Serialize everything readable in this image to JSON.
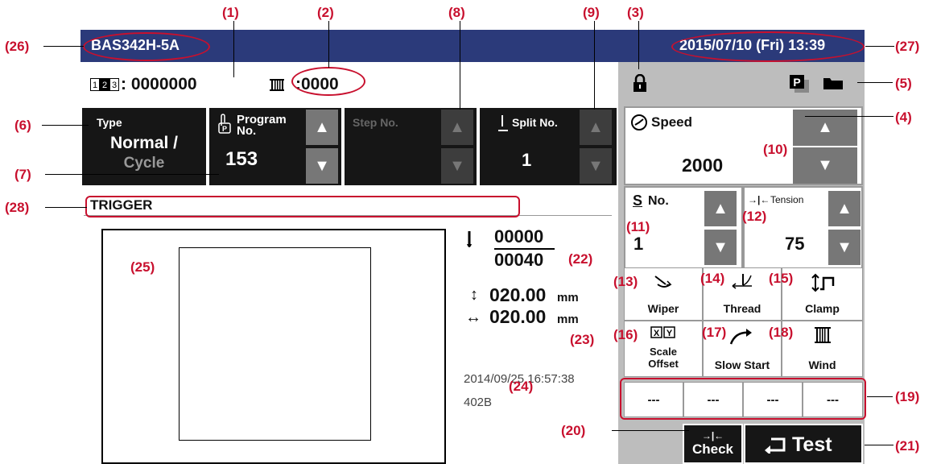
{
  "title_bar": {
    "model": "BAS342H-5A",
    "datetime": "2015/07/10 (Fri) 13:39"
  },
  "counters": {
    "production_count": ": 0000000",
    "bobbin_count": ":0000"
  },
  "tiles": {
    "type": {
      "label": "Type",
      "value_line1": "Normal /",
      "value_line2": "Cycle"
    },
    "program": {
      "label_line1": "Program",
      "label_line2": "No.",
      "value": "153"
    },
    "step": {
      "label": "Step No.",
      "value": ""
    },
    "split": {
      "label": "Split No.",
      "value": "1"
    }
  },
  "trigger_label": "TRIGGER",
  "stitch": {
    "current": "00000",
    "total": "00040"
  },
  "dimensions": {
    "height": "020.00",
    "width": "020.00",
    "unit": "mm"
  },
  "file_info": {
    "date": "2014/09/25 16:57:38",
    "code": "402B"
  },
  "speed": {
    "label": "Speed",
    "value": "2000"
  },
  "s_no": {
    "label": "No.",
    "value": "1"
  },
  "tension": {
    "label": "Tension",
    "value": "75"
  },
  "functions": {
    "wiper": "Wiper",
    "thread": "Thread",
    "clamp": "Clamp",
    "scale_offset_line1": "Scale",
    "scale_offset_line2": "Offset",
    "slow_start": "Slow Start",
    "wind": "Wind"
  },
  "custom_slots": [
    "---",
    "---",
    "---",
    "---"
  ],
  "check_label": "Check",
  "test_label": "Test",
  "icons": {
    "lock": "lock-icon",
    "program_p": "program-p-icon",
    "folder": "folder-icon",
    "speed": "speedometer-icon",
    "counter": "counter-123-icon",
    "bobbin": "bobbin-icon",
    "needle": "needle-icon",
    "up": "arrow-up-icon",
    "down": "arrow-down-icon"
  },
  "colors": {
    "title_bar": "#2b3a7a",
    "callout": "#c8102e",
    "dark_tile": "#161616",
    "panel": "#bdbdbd"
  },
  "callouts": [
    "(1)",
    "(2)",
    "(3)",
    "(4)",
    "(5)",
    "(6)",
    "(7)",
    "(8)",
    "(9)",
    "(10)",
    "(11)",
    "(12)",
    "(13)",
    "(14)",
    "(15)",
    "(16)",
    "(17)",
    "(18)",
    "(19)",
    "(20)",
    "(21)",
    "(22)",
    "(23)",
    "(24)",
    "(25)",
    "(26)",
    "(27)",
    "(28)"
  ]
}
